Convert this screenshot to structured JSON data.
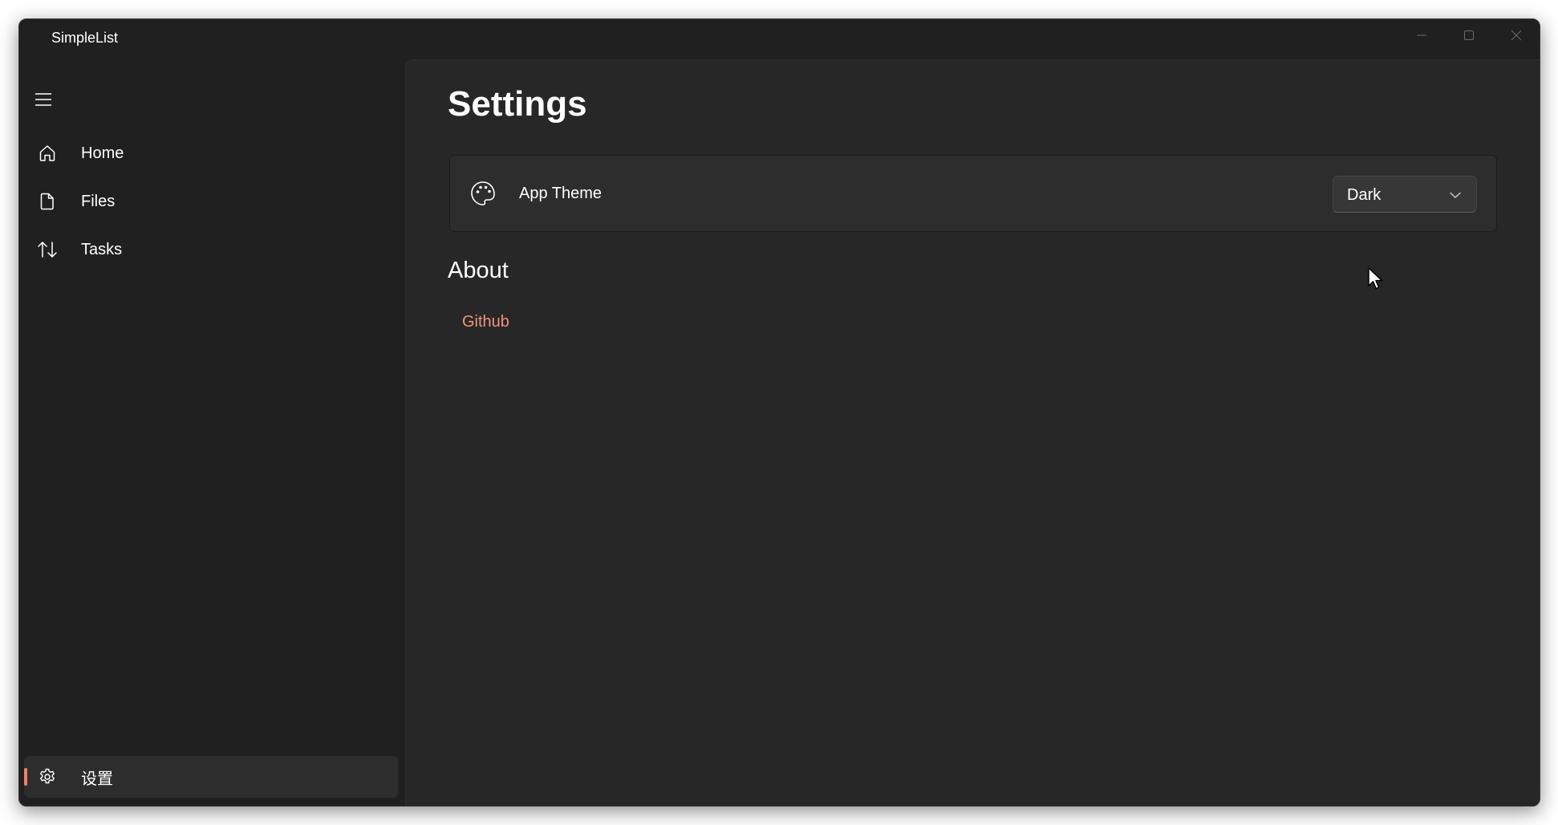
{
  "window": {
    "title": "SimpleList"
  },
  "icons": {
    "menu": "hamburger-icon",
    "home": "home-icon",
    "files": "document-icon",
    "tasks": "sort-arrows-icon",
    "settings": "gear-icon",
    "theme": "palette-icon",
    "dropdown": "chevron-down-icon",
    "minimize": "minimize-icon",
    "maximize": "maximize-icon",
    "close": "close-icon"
  },
  "sidebar": {
    "items": [
      {
        "label": "Home"
      },
      {
        "label": "Files"
      },
      {
        "label": "Tasks"
      }
    ],
    "footer": {
      "label": "设置",
      "selected": true
    }
  },
  "main": {
    "title": "Settings",
    "theme_setting": {
      "label": "App Theme",
      "selected_value": "Dark"
    },
    "about": {
      "title": "About",
      "link_label": "Github"
    }
  },
  "colors": {
    "accent": "#f07f6a",
    "link": "#f0937c",
    "window_bg": "#202020",
    "content_bg": "#272727",
    "card_bg": "#2d2d2d"
  }
}
